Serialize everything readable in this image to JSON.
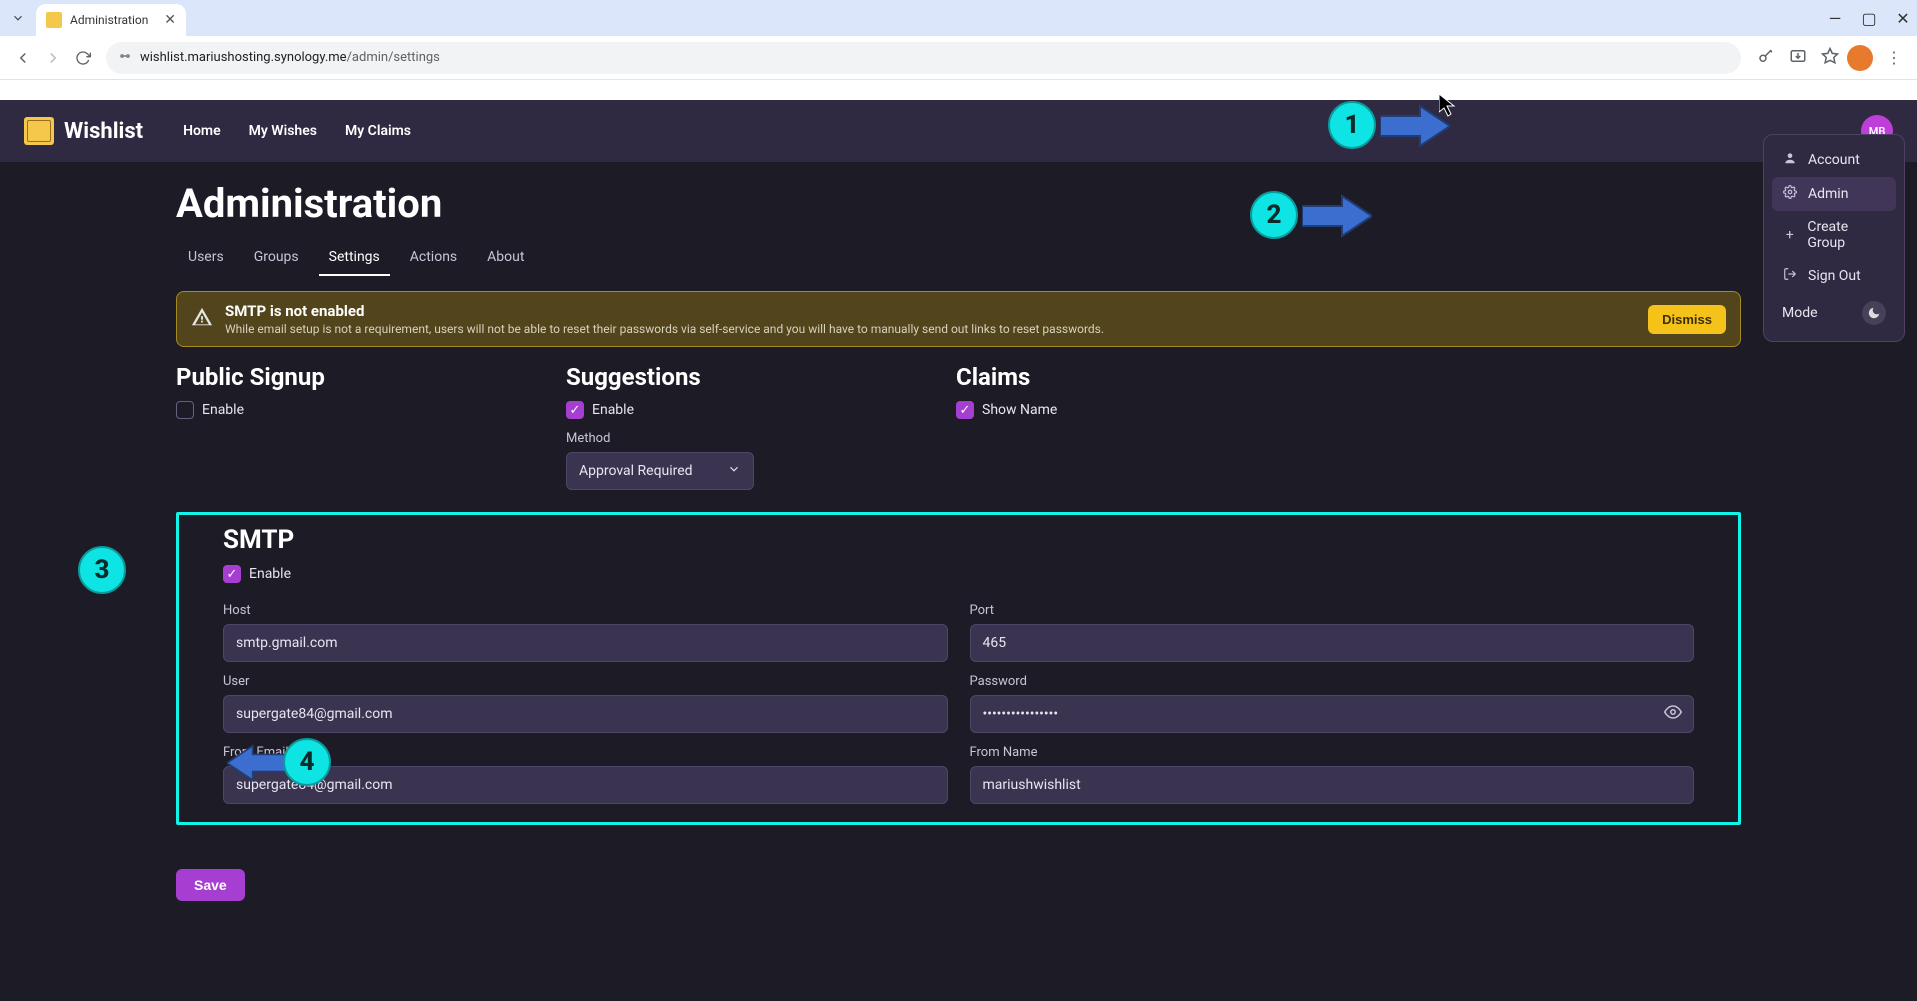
{
  "browser": {
    "tab_title": "Administration",
    "url_domain": "wishlist.mariushosting.synology.me",
    "url_path": "/admin/settings"
  },
  "nav": {
    "app_title": "Wishlist",
    "links": [
      "Home",
      "My Wishes",
      "My Claims"
    ],
    "user_initials": "MB"
  },
  "page": {
    "title": "Administration",
    "tabs": [
      "Users",
      "Groups",
      "Settings",
      "Actions",
      "About"
    ],
    "active_tab": "Settings"
  },
  "banner": {
    "title": "SMTP is not enabled",
    "subtitle": "While email setup is not a requirement, users will not be able to reset their passwords via self-service and you will have to manually send out links to reset passwords.",
    "dismiss_label": "Dismiss"
  },
  "sections": {
    "public_signup": {
      "title": "Public Signup",
      "enable_label": "Enable",
      "enabled": false
    },
    "suggestions": {
      "title": "Suggestions",
      "enable_label": "Enable",
      "enabled": true,
      "method_label": "Method",
      "method_value": "Approval Required"
    },
    "claims": {
      "title": "Claims",
      "show_label": "Show Name",
      "show_name": true
    }
  },
  "smtp": {
    "title": "SMTP",
    "enable_label": "Enable",
    "enabled": true,
    "fields": {
      "host": {
        "label": "Host",
        "value": "smtp.gmail.com"
      },
      "port": {
        "label": "Port",
        "value": "465"
      },
      "user": {
        "label": "User",
        "value": "supergate84@gmail.com"
      },
      "password": {
        "label": "Password",
        "value": "••••••••••••••••"
      },
      "from_email": {
        "label": "From Email",
        "value": "supergate84@gmail.com"
      },
      "from_name": {
        "label": "From Name",
        "value": "mariushwishlist"
      }
    }
  },
  "save_label": "Save",
  "dropdown": {
    "account": "Account",
    "admin": "Admin",
    "create_group": "Create Group",
    "sign_out": "Sign Out",
    "mode": "Mode"
  },
  "annotations": {
    "n1": "1",
    "n2": "2",
    "n3": "3",
    "n4": "4"
  }
}
